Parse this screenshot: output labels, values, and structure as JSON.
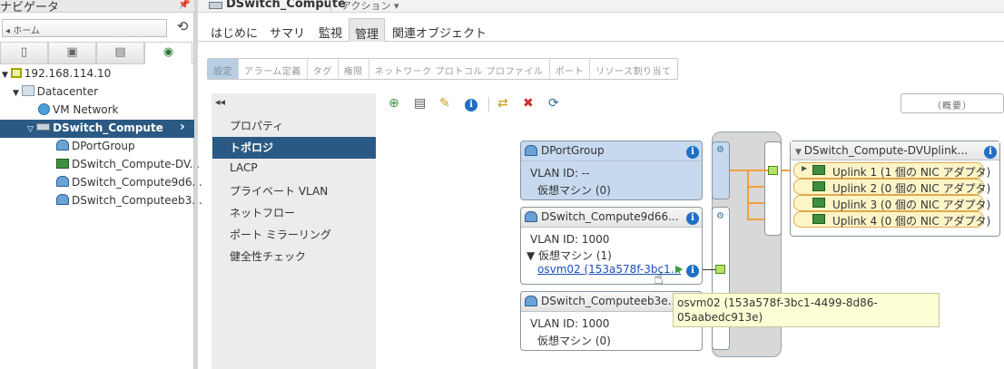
{
  "navigator": {
    "title": "ナビゲータ",
    "back_label": "ホーム",
    "tree": {
      "host": "192.168.114.10",
      "datacenter": "Datacenter",
      "vm_network": "VM Network",
      "selected": "DSwitch_Compute",
      "children": [
        "DPortGroup",
        "DSwitch_Compute-DV...",
        "DSwitch_Compute9d6...",
        "DSwitch_Computeeb3..."
      ]
    }
  },
  "header": {
    "object_title": "DSwitch_Compute",
    "actions_label": "アクション ▾",
    "tabs": [
      "はじめに",
      "サマリ",
      "監視",
      "管理",
      "関連オブジェクト"
    ],
    "active_tab": "管理"
  },
  "subtabs": [
    "設定",
    "アラーム定義",
    "タグ",
    "権限",
    "ネットワーク プロトコル プロファイル",
    "ポート",
    "リソース割り当て"
  ],
  "side_menu": [
    "プロパティ",
    "トポロジ",
    "LACP",
    "プライベート VLAN",
    "ネットフロー",
    "ポート ミラーリング",
    "健全性チェック"
  ],
  "summary_label": "（概要）",
  "topology": {
    "groups": [
      {
        "name": "DPortGroup",
        "vlan": "VLAN ID: --",
        "vms": "仮想マシン (0)"
      },
      {
        "name": "DSwitch_Compute9d66...",
        "vlan": "VLAN ID:  1000",
        "vms": "▼ 仮想マシン (1)",
        "vm_link": "osvm02 (153a578f-3bc1..."
      },
      {
        "name": "DSwitch_Computeeb3e...",
        "vlan": "VLAN ID:  1000",
        "vms": "仮想マシン (0)"
      }
    ],
    "uplink_group": "DSwitch_Compute-DVUplink...",
    "uplinks": [
      "Uplink 1 (1 個の NIC アダプタ)",
      "Uplink 2 (0 個の NIC アダプタ)",
      "Uplink 3 (0 個の NIC アダプタ)",
      "Uplink 4 (0 個の NIC アダプタ)"
    ],
    "tooltip": "osvm02 (153a578f-3bc1-4499-8d86-05aabedc913e)"
  },
  "colors": {
    "selection": "#2a5a84",
    "portgroup_blue": "#c7d9ef",
    "uplink_orange": "#f0a040",
    "info_blue": "#1f6fc5"
  }
}
